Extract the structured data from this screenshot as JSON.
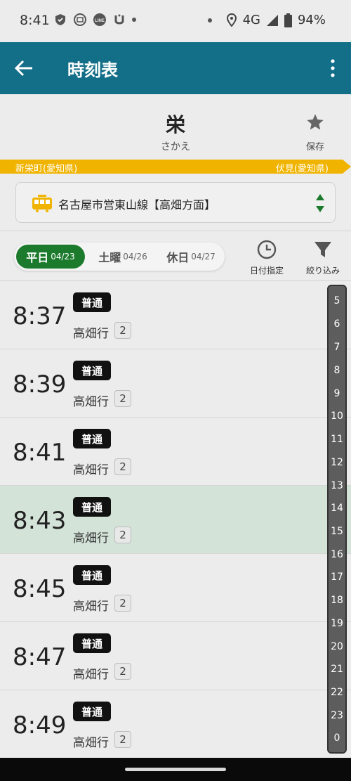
{
  "status_bar": {
    "time": "8:41",
    "network": "4G",
    "battery": "94%"
  },
  "app_bar": {
    "title": "時刻表"
  },
  "station": {
    "name": "栄",
    "kana": "さかえ",
    "save_label": "保存"
  },
  "direction": {
    "from": "新栄町(愛知県)",
    "to": "伏見(愛知県)",
    "color": "#f0b400"
  },
  "line": {
    "name": "名古屋市営東山線【高畑方面】",
    "icon": "train-icon"
  },
  "day_tabs": [
    {
      "label": "平日",
      "date": "04/23",
      "active": true
    },
    {
      "label": "土曜",
      "date": "04/26",
      "active": false
    },
    {
      "label": "休日",
      "date": "04/27",
      "active": false
    }
  ],
  "tools": {
    "date_select": "日付指定",
    "filter": "絞り込み"
  },
  "departures": [
    {
      "time": "8:37",
      "type": "普通",
      "destination": "高畑行",
      "cars": "2",
      "highlight": false
    },
    {
      "time": "8:39",
      "type": "普通",
      "destination": "高畑行",
      "cars": "2",
      "highlight": false
    },
    {
      "time": "8:41",
      "type": "普通",
      "destination": "高畑行",
      "cars": "2",
      "highlight": false
    },
    {
      "time": "8:43",
      "type": "普通",
      "destination": "高畑行",
      "cars": "2",
      "highlight": true
    },
    {
      "time": "8:45",
      "type": "普通",
      "destination": "高畑行",
      "cars": "2",
      "highlight": false
    },
    {
      "time": "8:47",
      "type": "普通",
      "destination": "高畑行",
      "cars": "2",
      "highlight": false
    },
    {
      "time": "8:49",
      "type": "普通",
      "destination": "高畑行",
      "cars": "2",
      "highlight": false
    }
  ],
  "hour_index": [
    "5",
    "6",
    "7",
    "8",
    "9",
    "10",
    "11",
    "12",
    "13",
    "14",
    "15",
    "16",
    "17",
    "18",
    "19",
    "20",
    "21",
    "22",
    "23",
    "0"
  ],
  "colors": {
    "app_bar": "#136e88",
    "active_tab": "#1c7a2c",
    "highlight_row": "#d4e3d8"
  }
}
